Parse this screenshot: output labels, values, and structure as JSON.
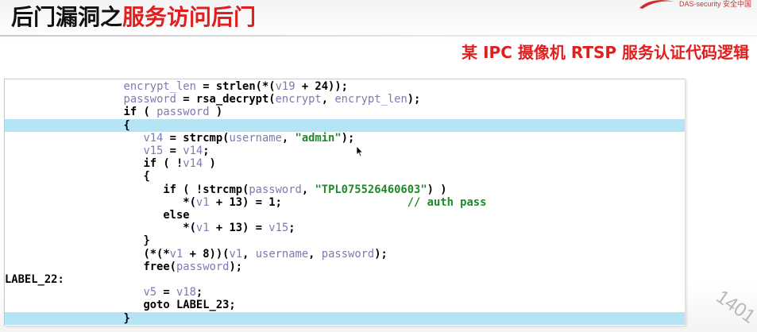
{
  "header": {
    "title_black": "后门漏洞之",
    "title_red": "服务访问后门",
    "logo_text": "DAS-security 安全中国",
    "subtitle": "某 IPC 摄像机 RTSP 服务认证代码逻辑"
  },
  "code": {
    "lines": [
      {
        "indent": 18,
        "highlight": false,
        "parts": [
          {
            "t": "encrypt_len",
            "c": "v"
          },
          {
            "t": " = ",
            "c": "k"
          },
          {
            "t": "strlen",
            "c": "k"
          },
          {
            "t": "(*(",
            "c": "k"
          },
          {
            "t": "v19",
            "c": "v"
          },
          {
            "t": " + 24));",
            "c": "k"
          }
        ]
      },
      {
        "indent": 18,
        "highlight": false,
        "parts": [
          {
            "t": "password",
            "c": "v"
          },
          {
            "t": " = ",
            "c": "k"
          },
          {
            "t": "rsa_decrypt",
            "c": "k"
          },
          {
            "t": "(",
            "c": "k"
          },
          {
            "t": "encrypt",
            "c": "v"
          },
          {
            "t": ", ",
            "c": "k"
          },
          {
            "t": "encrypt_len",
            "c": "v"
          },
          {
            "t": ");",
            "c": "k"
          }
        ]
      },
      {
        "indent": 18,
        "highlight": false,
        "parts": [
          {
            "t": "if",
            "c": "k"
          },
          {
            "t": " ( ",
            "c": "k"
          },
          {
            "t": "password",
            "c": "v"
          },
          {
            "t": " )",
            "c": "k"
          }
        ]
      },
      {
        "indent": 18,
        "highlight": true,
        "parts": [
          {
            "t": "{",
            "c": "k"
          }
        ]
      },
      {
        "indent": 21,
        "highlight": false,
        "parts": [
          {
            "t": "v14",
            "c": "v"
          },
          {
            "t": " = ",
            "c": "k"
          },
          {
            "t": "strcmp",
            "c": "k"
          },
          {
            "t": "(",
            "c": "k"
          },
          {
            "t": "username",
            "c": "v"
          },
          {
            "t": ", ",
            "c": "k"
          },
          {
            "t": "\"admin\"",
            "c": "s"
          },
          {
            "t": ");",
            "c": "k"
          }
        ]
      },
      {
        "indent": 21,
        "highlight": false,
        "parts": [
          {
            "t": "v15",
            "c": "v"
          },
          {
            "t": " = ",
            "c": "k"
          },
          {
            "t": "v14",
            "c": "v"
          },
          {
            "t": ";",
            "c": "k"
          }
        ]
      },
      {
        "indent": 21,
        "highlight": false,
        "parts": [
          {
            "t": "if",
            "c": "k"
          },
          {
            "t": " ( !",
            "c": "k"
          },
          {
            "t": "v14",
            "c": "v"
          },
          {
            "t": " )",
            "c": "k"
          }
        ]
      },
      {
        "indent": 21,
        "highlight": false,
        "parts": [
          {
            "t": "{",
            "c": "k"
          }
        ]
      },
      {
        "indent": 24,
        "highlight": false,
        "parts": [
          {
            "t": "if",
            "c": "k"
          },
          {
            "t": " ( !",
            "c": "k"
          },
          {
            "t": "strcmp",
            "c": "k"
          },
          {
            "t": "(",
            "c": "k"
          },
          {
            "t": "password",
            "c": "v"
          },
          {
            "t": ", ",
            "c": "k"
          },
          {
            "t": "\"TPL075526460603\"",
            "c": "s"
          },
          {
            "t": ") )",
            "c": "k"
          }
        ]
      },
      {
        "indent": 27,
        "highlight": false,
        "parts": [
          {
            "t": "*(",
            "c": "k"
          },
          {
            "t": "v1",
            "c": "v"
          },
          {
            "t": " + 13) = 1;",
            "c": "k"
          },
          {
            "t": "                   // auth pass",
            "c": "c"
          }
        ]
      },
      {
        "indent": 24,
        "highlight": false,
        "parts": [
          {
            "t": "else",
            "c": "k"
          }
        ]
      },
      {
        "indent": 27,
        "highlight": false,
        "parts": [
          {
            "t": "*(",
            "c": "k"
          },
          {
            "t": "v1",
            "c": "v"
          },
          {
            "t": " + 13) = ",
            "c": "k"
          },
          {
            "t": "v15",
            "c": "v"
          },
          {
            "t": ";",
            "c": "k"
          }
        ]
      },
      {
        "indent": 21,
        "highlight": false,
        "parts": [
          {
            "t": "}",
            "c": "k"
          }
        ]
      },
      {
        "indent": 21,
        "highlight": false,
        "parts": [
          {
            "t": "(*(*",
            "c": "k"
          },
          {
            "t": "v1",
            "c": "v"
          },
          {
            "t": " + 8))(",
            "c": "k"
          },
          {
            "t": "v1",
            "c": "v"
          },
          {
            "t": ", ",
            "c": "k"
          },
          {
            "t": "username",
            "c": "v"
          },
          {
            "t": ", ",
            "c": "k"
          },
          {
            "t": "password",
            "c": "v"
          },
          {
            "t": ");",
            "c": "k"
          }
        ]
      },
      {
        "indent": 21,
        "highlight": false,
        "parts": [
          {
            "t": "free",
            "c": "k"
          },
          {
            "t": "(",
            "c": "k"
          },
          {
            "t": "password",
            "c": "v"
          },
          {
            "t": ");",
            "c": "k"
          }
        ]
      },
      {
        "indent": 0,
        "highlight": false,
        "parts": [
          {
            "t": "LABEL_22:",
            "c": "l"
          }
        ]
      },
      {
        "indent": 21,
        "highlight": false,
        "parts": [
          {
            "t": "v5",
            "c": "v"
          },
          {
            "t": " = ",
            "c": "k"
          },
          {
            "t": "v18",
            "c": "v"
          },
          {
            "t": ";",
            "c": "k"
          }
        ]
      },
      {
        "indent": 21,
        "highlight": false,
        "parts": [
          {
            "t": "goto",
            "c": "k"
          },
          {
            "t": " LABEL_23;",
            "c": "k"
          }
        ]
      },
      {
        "indent": 18,
        "highlight": true,
        "parts": [
          {
            "t": "}",
            "c": "k"
          }
        ]
      }
    ]
  },
  "watermark": "1401"
}
